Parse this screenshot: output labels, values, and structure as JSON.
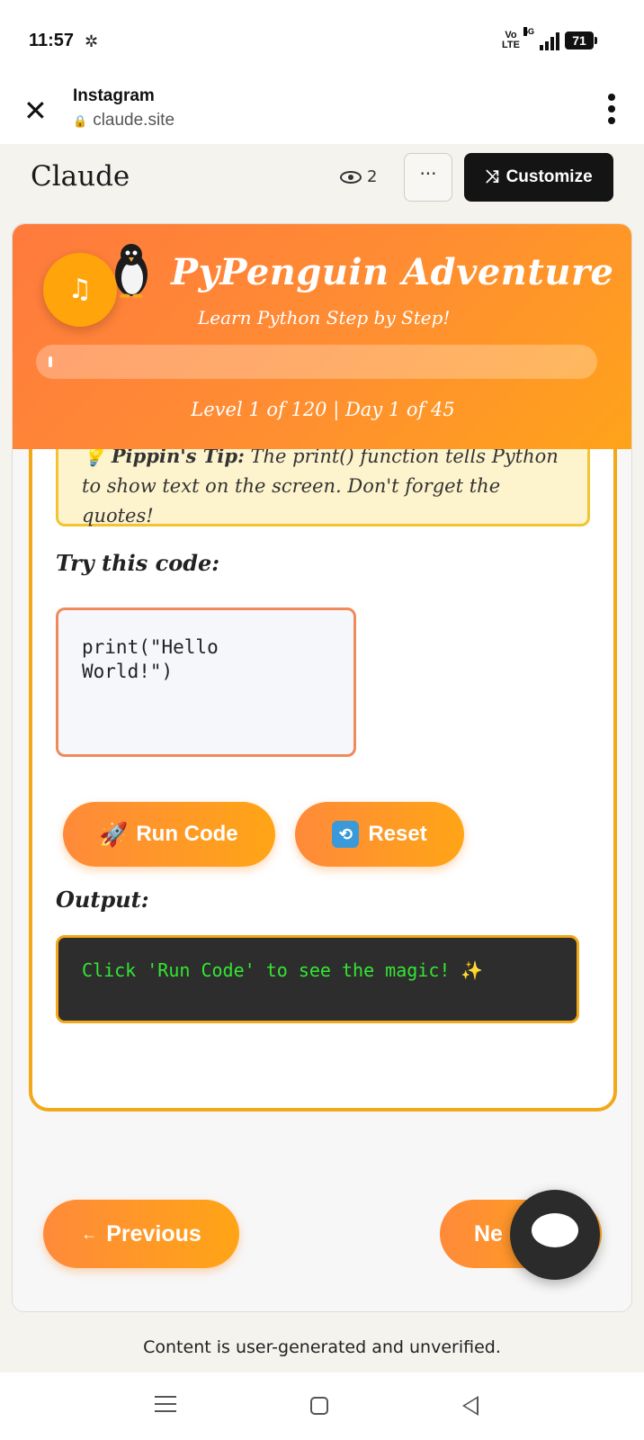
{
  "status_bar": {
    "time": "11:57",
    "network_label": "Vo LTE",
    "network_top": "Vo",
    "network_bottom": "LTE",
    "signal_type": "5G",
    "battery": "71"
  },
  "browser": {
    "app_name": "Instagram",
    "url": "claude.site"
  },
  "claude_bar": {
    "logo": "Claude",
    "view_count": "2",
    "more_label": "···",
    "customize_label": "Customize"
  },
  "app": {
    "header": {
      "title": "PyPenguin Adventure",
      "subtitle": "Learn Python Step by Step!",
      "progress_fraction": 0.01,
      "level_text": "Level 1 of 120 | Day 1 of 45",
      "music_icon": "♫"
    },
    "lesson": {
      "tip_label": "Pippin's Tip:",
      "tip_text": " The print() function tells Python to show text on the screen. Don't forget the quotes!",
      "try_label": "Try this code:",
      "code": "print(\"Hello\nWorld!\")",
      "run_label": "Run Code",
      "reset_label": "Reset",
      "output_label": "Output:",
      "output_text": "Click 'Run Code' to see the magic! ✨"
    },
    "nav": {
      "previous_label": "Previous",
      "next_label": "Ne"
    }
  },
  "footer": {
    "disclaimer": "Content is user-generated and unverified."
  },
  "colors": {
    "accent_orange": "#ff8c33",
    "output_green": "#33e633",
    "tip_bg": "#fdf3cc"
  }
}
